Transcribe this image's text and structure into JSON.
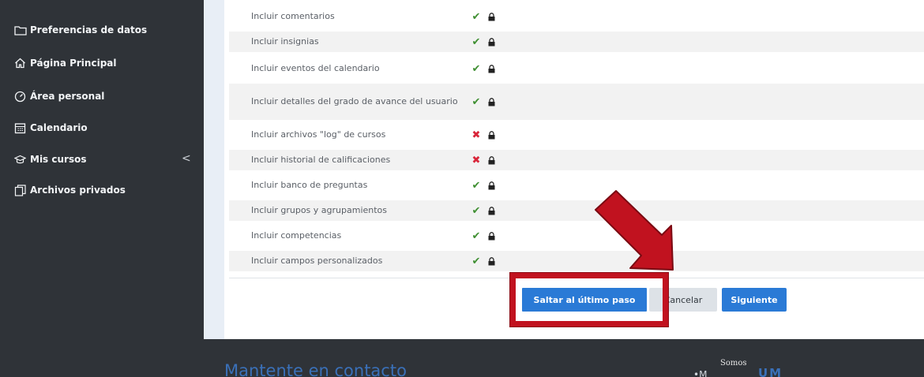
{
  "sidebar": {
    "items": [
      {
        "label": "Preferencias de datos",
        "icon": "folder-icon"
      },
      {
        "label": "Página Principal",
        "icon": "home-icon"
      },
      {
        "label": "Área personal",
        "icon": "dashboard-icon"
      },
      {
        "label": "Calendario",
        "icon": "calendar-icon"
      },
      {
        "label": "Mis cursos",
        "icon": "graduation-cap-icon"
      },
      {
        "label": "Archivos privados",
        "icon": "files-icon"
      }
    ],
    "collapse_glyph": "<"
  },
  "settings": {
    "rows": [
      {
        "label": "Incluir comentarios",
        "status": "included",
        "glyph": "✔"
      },
      {
        "label": "Incluir insignias",
        "status": "included",
        "glyph": "✔"
      },
      {
        "label": "Incluir eventos del calendario",
        "status": "included",
        "glyph": "✔"
      },
      {
        "label": "Incluir detalles del grado de avance del usuario",
        "status": "included",
        "glyph": "✔"
      },
      {
        "label": "Incluir archivos \"log\" de cursos",
        "status": "excluded",
        "glyph": "✖"
      },
      {
        "label": "Incluir historial de calificaciones",
        "status": "excluded",
        "glyph": "✖"
      },
      {
        "label": "Incluir banco de preguntas",
        "status": "included",
        "glyph": "✔"
      },
      {
        "label": "Incluir grupos y agrupamientos",
        "status": "included",
        "glyph": "✔"
      },
      {
        "label": "Incluir competencias",
        "status": "included",
        "glyph": "✔"
      },
      {
        "label": "Incluir campos personalizados",
        "status": "included",
        "glyph": "✔"
      }
    ]
  },
  "actions": {
    "skip_label": "Saltar al último paso",
    "cancel_label": "Cancelar",
    "next_label": "Siguiente"
  },
  "footer": {
    "title": "Mantente en contacto",
    "logo_small": "Somos",
    "logo_a": "•M",
    "logo_b": "UM"
  },
  "colors": {
    "sidebar_bg": "#2f3338",
    "accent_blue": "#2a7ad6",
    "check_green": "#3f8f32",
    "cross_red": "#d9263a",
    "highlight_red": "#c1121f"
  }
}
